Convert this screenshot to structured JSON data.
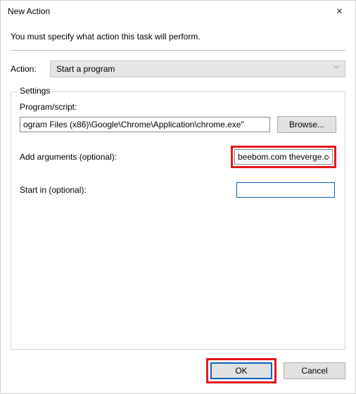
{
  "window": {
    "title": "New Action"
  },
  "instruction": "You must specify what action this task will perform.",
  "action": {
    "label": "Action:",
    "selected": "Start a program"
  },
  "settings": {
    "legend": "Settings",
    "program_label": "Program/script:",
    "program_value": "ogram Files (x86)\\Google\\Chrome\\Application\\chrome.exe\"",
    "browse_label": "Browse...",
    "args_label": "Add arguments (optional):",
    "args_value": "beebom.com theverge.co",
    "startin_label": "Start in (optional):",
    "startin_value": ""
  },
  "buttons": {
    "ok": "OK",
    "cancel": "Cancel"
  }
}
